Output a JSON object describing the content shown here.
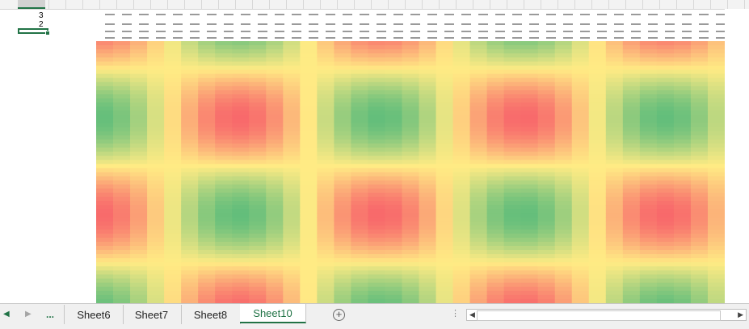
{
  "row_numbers": [
    "3",
    "2"
  ],
  "sheet_tabs": [
    {
      "label": "Sheet6",
      "active": false
    },
    {
      "label": "Sheet7",
      "active": false
    },
    {
      "label": "Sheet8",
      "active": false
    },
    {
      "label": "Sheet10",
      "active": true
    }
  ],
  "overflow_tabs_label": "...",
  "icons": {
    "prev_sheet": "triangle-left-icon",
    "next_sheet": "triangle-right-icon",
    "add_sheet": "plus-circle-icon",
    "split": "vertical-dots-icon"
  },
  "heatmap": {
    "colors": {
      "low": "#63be7b",
      "mid": "#ffeb84",
      "high": "#f8696b"
    }
  }
}
